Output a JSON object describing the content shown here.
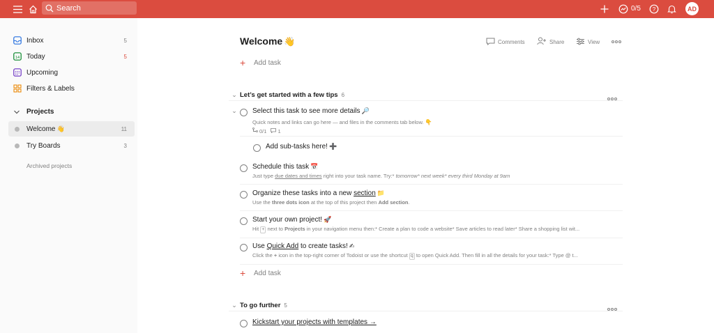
{
  "topbar": {
    "search_placeholder": "Search",
    "karma": "0/5",
    "avatar_initials": "AD",
    "color": "#db4c3f"
  },
  "sidebar": {
    "items": [
      {
        "label": "Inbox",
        "count": "5",
        "icon": "inbox-icon"
      },
      {
        "label": "Today",
        "count": "5",
        "icon": "calendar-today-icon"
      },
      {
        "label": "Upcoming",
        "count": "",
        "icon": "calendar-upcoming-icon"
      },
      {
        "label": "Filters & Labels",
        "count": "",
        "icon": "filters-icon"
      }
    ],
    "projects_heading": "Projects",
    "projects": [
      {
        "label": "Welcome",
        "emoji": "👋",
        "count": "11"
      },
      {
        "label": "Try Boards",
        "emoji": "",
        "count": "3"
      }
    ],
    "archived_label": "Archived projects"
  },
  "header": {
    "title": "Welcome",
    "title_emoji": "👋",
    "actions": {
      "comments": "Comments",
      "share": "Share",
      "view": "View"
    }
  },
  "add_task_label": "Add task",
  "sections": [
    {
      "name": "Let’s get started with a few tips",
      "count": "6",
      "tasks": [
        {
          "title": "Select this task to see more details",
          "emoji": "🔎",
          "desc": "Quick notes and links can go here — and files in the comments tab below.",
          "desc_emoji": "👇",
          "subtasks": "0/1",
          "comments": "1"
        },
        {
          "title": "Add sub-tasks here!",
          "emoji": "➕"
        },
        {
          "title": "Schedule this task",
          "emoji": "📅",
          "desc_a": "Just type",
          "desc_link": "due dates and times",
          "desc_b": "right into your task name. Try:*",
          "desc_c": "tomorrow* next week* every third Monday at 9am"
        },
        {
          "title_a": "Organize these tasks into a new",
          "title_link": "section",
          "emoji": "📁",
          "desc_a": "Use the",
          "desc_bold1": "three dots icon",
          "desc_b": "at the top of this project then",
          "desc_bold2": "Add section",
          "desc_c": "."
        },
        {
          "title": "Start your own project!",
          "emoji": "🚀",
          "desc_a": "Hit",
          "desc_key": "+",
          "desc_b": "next to",
          "desc_bold": "Projects",
          "desc_c": "in your navigation menu then:* Create a plan to code a website* Save articles to read later* Share a shopping list wit..."
        },
        {
          "title_a": "Use",
          "title_link": "Quick Add",
          "title_b": "to create tasks!",
          "emoji": "✍",
          "desc_a": "Click the",
          "desc_bold": "+",
          "desc_b": "icon in the top-right corner of Todoist or use the shortcut",
          "desc_key": "q",
          "desc_c": "to open Quick Add. Then fill in all the details for your task:* Type @ t..."
        }
      ]
    },
    {
      "name": "To go further",
      "count": "5",
      "tasks": [
        {
          "title": "Kickstart your projects with templates →"
        }
      ]
    }
  ]
}
